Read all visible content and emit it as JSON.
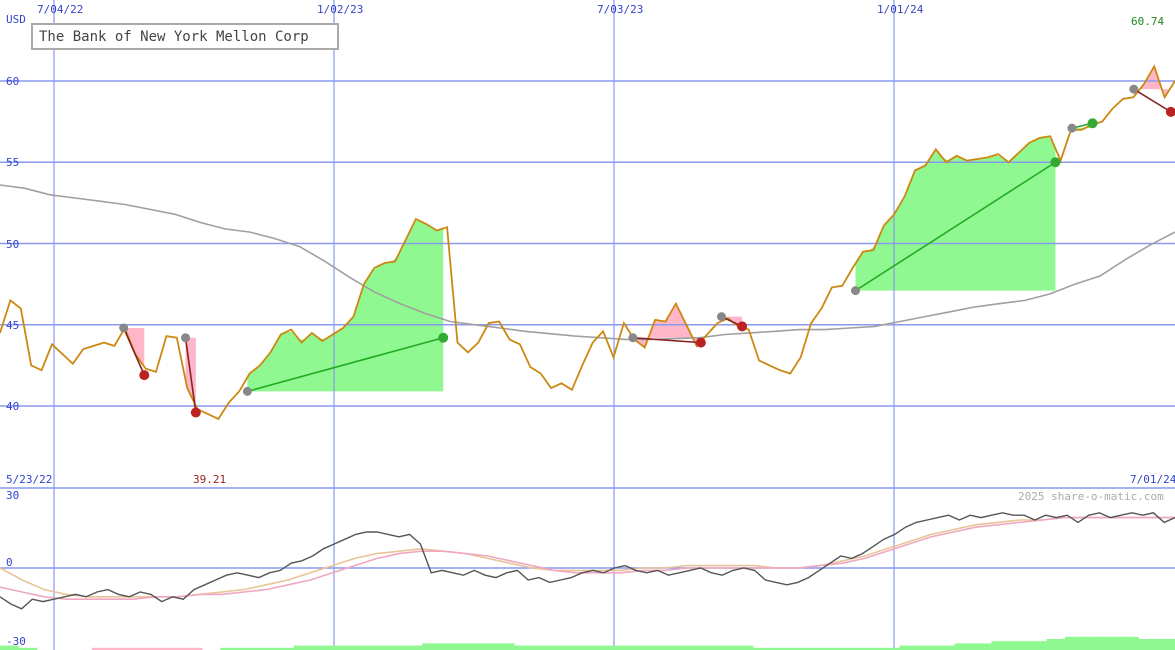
{
  "chart_data": {
    "type": "line",
    "title": "The Bank of New York Mellon Corp",
    "currency_label": "USD",
    "x_tick_labels_top": [
      "7/04/22",
      "1/02/23",
      "7/03/23",
      "1/01/24"
    ],
    "x_tick_labels_bottom": [
      "5/23/22",
      "7/01/24"
    ],
    "y_tick_labels": [
      "40",
      "45",
      "50",
      "55",
      "60"
    ],
    "ylim": [
      38.5,
      64.6
    ],
    "last_price_label": "60.74",
    "min_price_label": "39.21",
    "watermark": "2025 share-o-matic.com",
    "price_series": [
      44.5,
      46.5,
      46.0,
      42.5,
      42.2,
      43.8,
      43.2,
      42.6,
      43.5,
      43.7,
      43.9,
      43.7,
      44.8,
      43.2,
      42.3,
      42.1,
      44.3,
      44.2,
      41.1,
      39.8,
      39.5,
      39.2,
      40.2,
      40.9,
      42.0,
      42.5,
      43.3,
      44.4,
      44.7,
      43.9,
      44.5,
      44.0,
      44.4,
      44.8,
      45.5,
      47.5,
      48.5,
      48.8,
      48.9,
      50.2,
      51.5,
      51.2,
      50.8,
      51.0,
      43.9,
      43.3,
      43.9,
      45.1,
      45.2,
      44.1,
      43.8,
      42.4,
      42.0,
      41.1,
      41.4,
      41.0,
      42.5,
      43.9,
      44.6,
      43.0,
      45.1,
      44.1,
      43.6,
      45.3,
      45.2,
      46.3,
      45.0,
      43.7,
      44.4,
      45.1,
      45.4,
      44.9,
      44.7,
      42.8,
      42.5,
      42.2,
      42.0,
      43.0,
      45.1,
      46.0,
      47.3,
      47.4,
      48.5,
      49.5,
      49.6,
      51.1,
      51.8,
      52.9,
      54.5,
      54.8,
      55.8,
      55.0,
      55.4,
      55.1,
      55.2,
      55.3,
      55.5,
      55.0,
      55.6,
      56.2,
      56.5,
      56.6,
      55.1,
      57.0,
      57.0,
      57.3,
      57.5,
      58.3,
      58.9,
      59.0,
      59.8,
      60.9,
      59.0,
      60.0
    ],
    "ma_series": [
      53.6,
      53.4,
      53.0,
      52.8,
      52.6,
      52.4,
      52.1,
      51.8,
      51.3,
      50.9,
      50.7,
      50.3,
      49.8,
      48.9,
      47.9,
      47.0,
      46.3,
      45.7,
      45.2,
      45.0,
      44.8,
      44.6,
      44.45,
      44.3,
      44.2,
      44.1,
      44.1,
      44.15,
      44.2,
      44.4,
      44.5,
      44.6,
      44.7,
      44.7,
      44.8,
      44.9,
      45.2,
      45.5,
      45.8,
      46.1,
      46.3,
      46.5,
      46.9,
      47.5,
      48.0,
      49.0,
      49.9,
      50.7
    ],
    "trade_markers": [
      {
        "x0": 6,
        "y0": 44.8,
        "x1": 7,
        "y1": 41.9,
        "result": "loss"
      },
      {
        "x0": 9,
        "y0": 44.2,
        "x1": 9.5,
        "y1": 39.6,
        "result": "loss"
      },
      {
        "x0": 12,
        "y0": 40.9,
        "x1": 21.5,
        "y1": 44.2,
        "result": "gain"
      },
      {
        "x0": 30.7,
        "y0": 44.2,
        "x1": 34,
        "y1": 43.9,
        "result": "loss"
      },
      {
        "x0": 35,
        "y0": 45.5,
        "x1": 36,
        "y1": 44.9,
        "result": "loss"
      },
      {
        "x0": 41.5,
        "y0": 47.1,
        "x1": 51.2,
        "y1": 55.0,
        "result": "gain"
      },
      {
        "x0": 52,
        "y0": 57.1,
        "x1": 53,
        "y1": 57.4,
        "result": "gain"
      },
      {
        "x0": 55,
        "y0": 59.5,
        "x1": 56.8,
        "y1": 58.1,
        "result": "loss"
      }
    ],
    "oscillator": {
      "y_tick_labels": [
        "30",
        "0",
        "-30"
      ],
      "ylim": [
        -33,
        30
      ],
      "main": [
        -12,
        -15,
        -17,
        -13,
        -14,
        -13,
        -12,
        -11,
        -12,
        -10,
        -9,
        -11,
        -12,
        -10,
        -11,
        -14,
        -12,
        -13,
        -9,
        -7,
        -5,
        -3,
        -2,
        -3,
        -4,
        -2,
        -1,
        2,
        3,
        5,
        8,
        10,
        12,
        14,
        15,
        15,
        14,
        13,
        14,
        10,
        -2,
        -1,
        -2,
        -3,
        -1,
        -3,
        -4,
        -2,
        -1,
        -5,
        -4,
        -6,
        -5,
        -4,
        -2,
        -1,
        -2,
        0,
        1,
        -1,
        -2,
        -1,
        -3,
        -2,
        -1,
        0,
        -2,
        -3,
        -1,
        0,
        -1,
        -5,
        -6,
        -7,
        -6,
        -4,
        -1,
        2,
        5,
        4,
        6,
        9,
        12,
        14,
        17,
        19,
        20,
        21,
        22,
        20,
        22,
        21,
        22,
        23,
        22,
        22,
        20,
        22,
        21,
        22,
        19,
        22,
        23,
        21,
        22,
        23,
        22,
        23,
        19,
        21
      ],
      "fast": [
        -8,
        -10,
        -12,
        -13,
        -13,
        -13,
        -13,
        -12,
        -12,
        -11,
        -11,
        -10,
        -9,
        -7,
        -5,
        -2,
        1,
        4,
        6,
        7,
        7,
        6,
        5,
        3,
        1,
        -1,
        -2,
        -2,
        -2,
        -1,
        -1,
        0,
        0,
        0,
        0,
        0,
        0,
        1,
        2,
        4,
        7,
        10,
        13,
        15,
        17,
        18,
        19,
        20,
        21,
        21,
        21,
        21,
        21,
        21
      ],
      "slow": [
        0,
        -5,
        -9,
        -11,
        -12,
        -12,
        -12,
        -12,
        -12,
        -11,
        -10,
        -9,
        -7,
        -5,
        -2,
        1,
        4,
        6,
        7,
        8,
        7,
        6,
        4,
        2,
        0,
        -1,
        -1,
        -1,
        -1,
        0,
        0,
        1,
        1,
        1,
        1,
        0,
        0,
        1,
        3,
        5,
        8,
        11,
        14,
        16,
        18,
        19,
        20,
        20,
        21,
        21,
        21,
        21,
        21,
        21
      ],
      "histogram": [
        2,
        1,
        0,
        0,
        0,
        -1,
        -1,
        -1,
        -1,
        -1,
        -1,
        0,
        1,
        1,
        1,
        1,
        2,
        2,
        2,
        2,
        2,
        2,
        2,
        3,
        3,
        3,
        3,
        3,
        2,
        2,
        2,
        2,
        2,
        2,
        2,
        2,
        2,
        2,
        2,
        2,
        2,
        1,
        1,
        1,
        1,
        1,
        1,
        1,
        1,
        2,
        2,
        2,
        3,
        3,
        4,
        4,
        4,
        5,
        6,
        6,
        6,
        6,
        5,
        5
      ]
    },
    "colors": {
      "price_line": "#cc8811",
      "ma_line": "#a0a0a0",
      "gain_fill": "#90f890",
      "loss_fill": "#ffb6c8",
      "gain_line": "#22aa22",
      "loss_line": "#882222",
      "entry_marker": "#888888",
      "gain_marker": "#33aa33",
      "loss_marker": "#bb2222",
      "grid": "#8899ee",
      "osc_main": "#555555",
      "osc_fast": "#f0a8c0",
      "osc_slow": "#e8c498"
    }
  }
}
